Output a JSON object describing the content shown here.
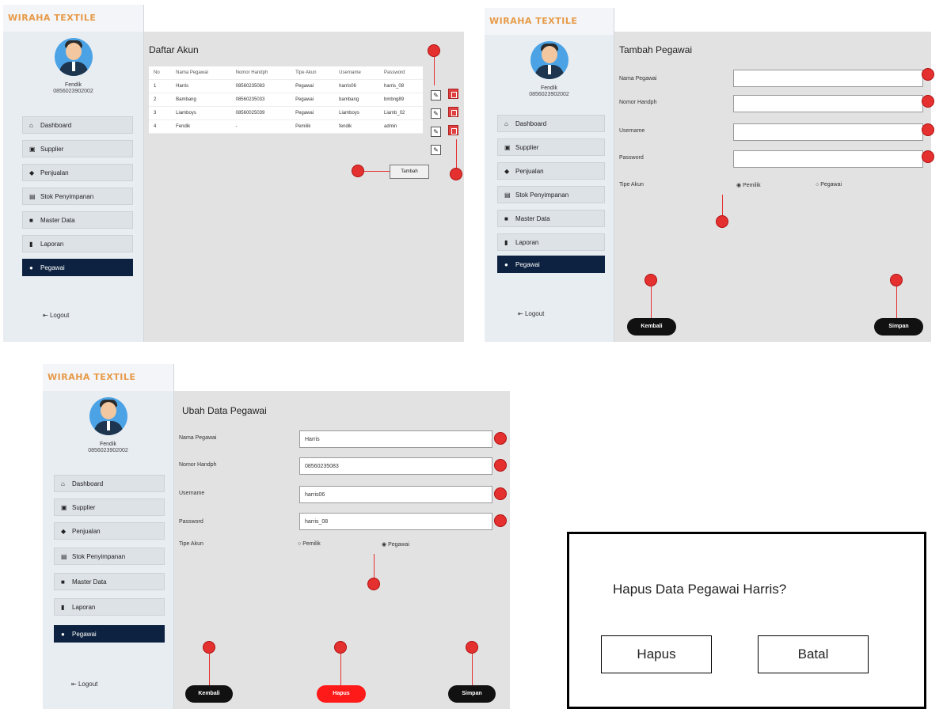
{
  "brand": "WIRAHA TEXTILE",
  "user": {
    "name": "Fendik",
    "phone": "0856023902002"
  },
  "nav": [
    "Dashboard",
    "Supplier",
    "Penjualan",
    "Stok Penyimpanan",
    "Master Data",
    "Laporan",
    "Pegawai"
  ],
  "logout": "Logout",
  "panel1": {
    "title": "Daftar Akun",
    "columns": [
      "No",
      "Nama Pegawai",
      "Nomor Handph",
      "Tipe Akun",
      "Username",
      "Password"
    ],
    "rows": [
      [
        "1",
        "Harris",
        "08560235083",
        "Pegawai",
        "harris06",
        "harris_08"
      ],
      [
        "2",
        "Bambang",
        "08560235033",
        "Pegawai",
        "bambang",
        "bmbng89"
      ],
      [
        "3",
        "Liamboys",
        "08560025039",
        "Pegawai",
        "Liamboys",
        "Liamb_02"
      ],
      [
        "4",
        "Fendik",
        "-",
        "Pemilik",
        "fendik",
        "admin"
      ]
    ],
    "add_label": "Tambah"
  },
  "panel2": {
    "title": "Tambah Pegawai",
    "labels": [
      "Nama Pegawai",
      "Nomor Handph",
      "Username",
      "Password",
      "Tipe Akun"
    ],
    "radio": [
      "Pemilik",
      "Pegawai"
    ],
    "back": "Kembali",
    "save": "Simpan"
  },
  "panel3": {
    "title": "Ubah Data Pegawai",
    "labels": [
      "Nama Pegawai",
      "Nomor Handph",
      "Username",
      "Password",
      "Tipe Akun"
    ],
    "values": [
      "Harris",
      "08560235083",
      "harris06",
      "harris_08"
    ],
    "radio": [
      "Pemilik",
      "Pegawai"
    ],
    "back": "Kembali",
    "delete": "Hapus",
    "save": "Simpan"
  },
  "dialog": {
    "question": "Hapus Data Pegawai Harris?",
    "confirm": "Hapus",
    "cancel": "Batal"
  },
  "colors": {
    "brand": "#e79a48",
    "active_nav": "#0d2240",
    "marker": "#e53030",
    "delete_btn": "#ff1a1a"
  },
  "icons": [
    "home-icon",
    "truck-icon",
    "cart-icon",
    "warehouse-icon",
    "folder-icon",
    "document-icon",
    "user-icon",
    "logout-icon",
    "edit-icon",
    "trash-icon"
  ]
}
